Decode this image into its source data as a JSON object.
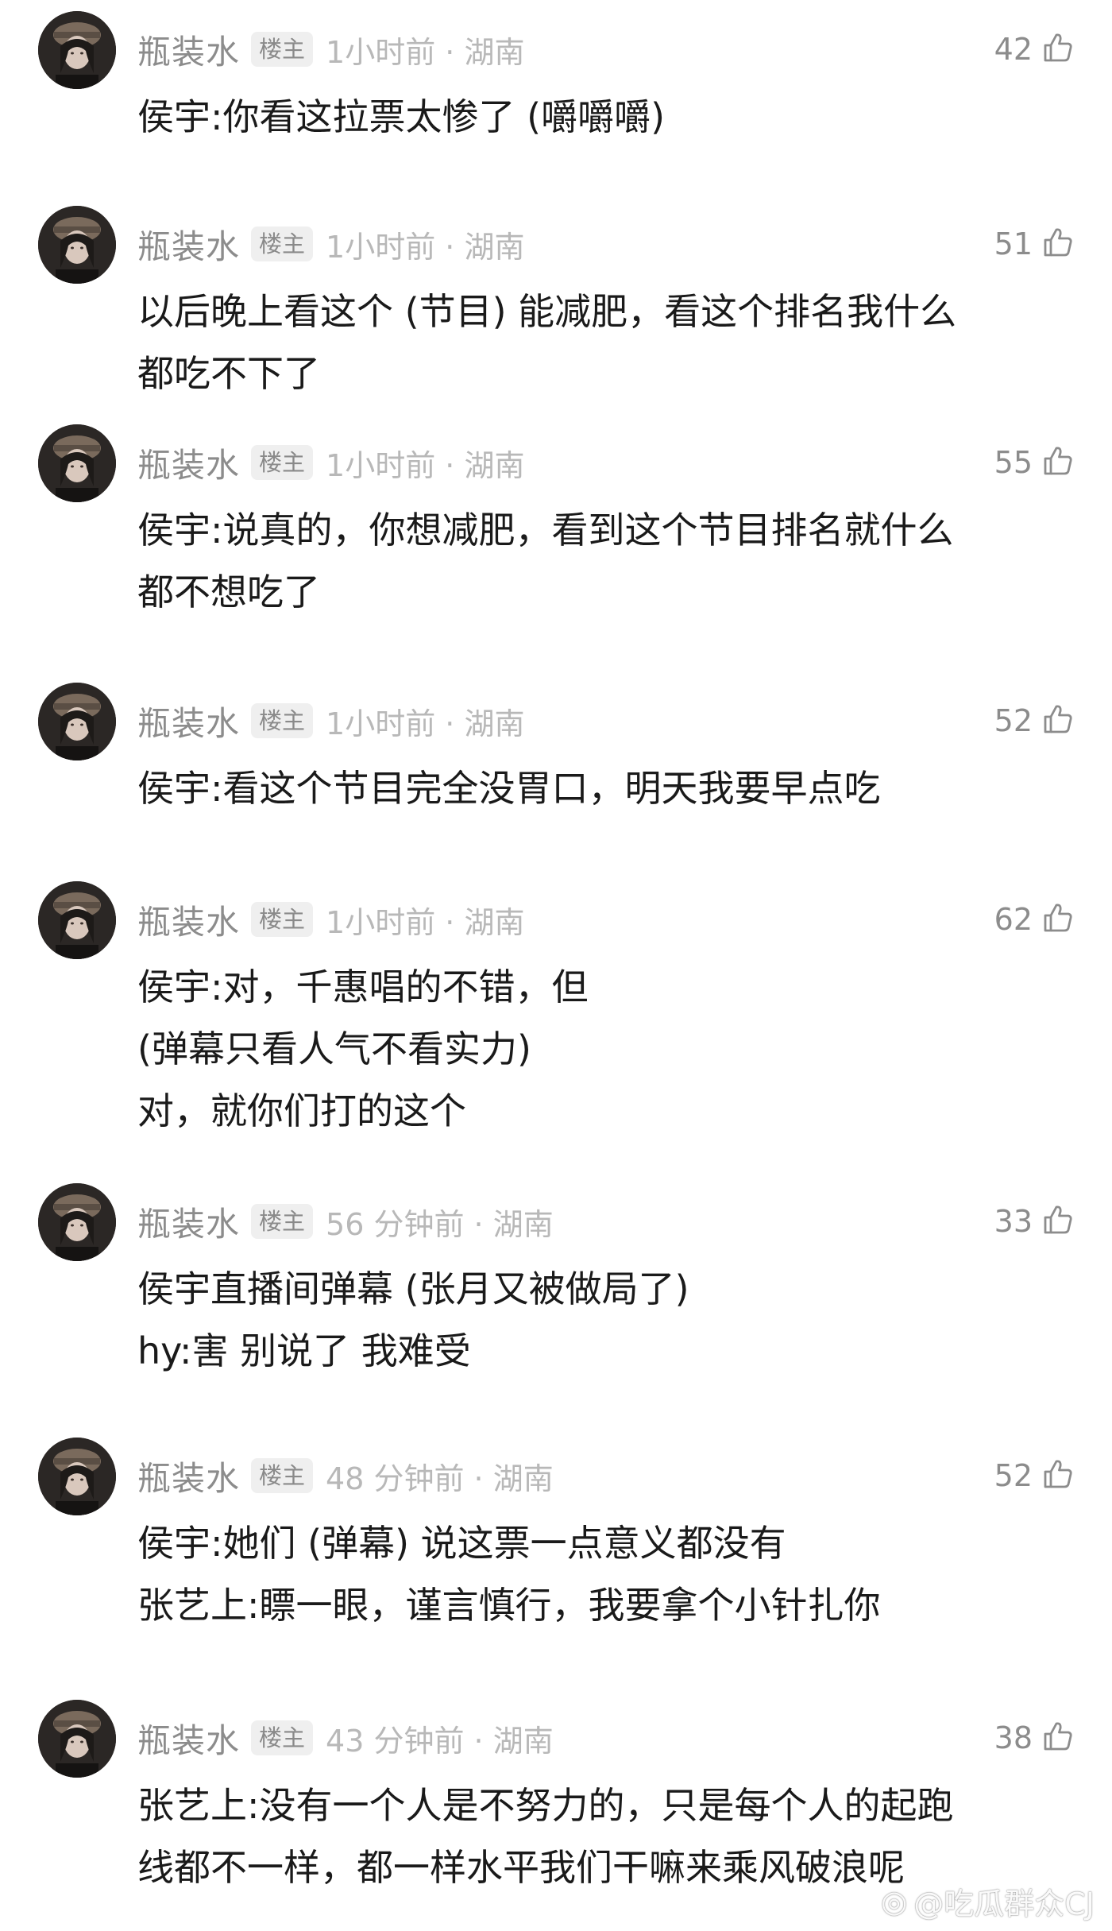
{
  "comments": [
    {
      "username": "瓶装水",
      "badge": "楼主",
      "time": "1小时前 · 湖南",
      "likes": "42",
      "lines": [
        "侯宇:你看这拉票太惨了 (嚼嚼嚼)"
      ]
    },
    {
      "username": "瓶装水",
      "badge": "楼主",
      "time": "1小时前 · 湖南",
      "likes": "51",
      "lines": [
        "以后晚上看这个 (节目) 能减肥，看这个排名我什么",
        "都吃不下了"
      ]
    },
    {
      "username": "瓶装水",
      "badge": "楼主",
      "time": "1小时前 · 湖南",
      "likes": "55",
      "lines": [
        "侯宇:说真的，你想减肥，看到这个节目排名就什么",
        "都不想吃了"
      ]
    },
    {
      "username": "瓶装水",
      "badge": "楼主",
      "time": "1小时前 · 湖南",
      "likes": "52",
      "lines": [
        "侯宇:看这个节目完全没胃口，明天我要早点吃"
      ]
    },
    {
      "username": "瓶装水",
      "badge": "楼主",
      "time": "1小时前 · 湖南",
      "likes": "62",
      "lines": [
        "侯宇:对，千惠唱的不错，但",
        "(弹幕只看人气不看实力)",
        "对，就你们打的这个"
      ]
    },
    {
      "username": "瓶装水",
      "badge": "楼主",
      "time": "56 分钟前 · 湖南",
      "likes": "33",
      "lines": [
        "侯宇直播间弹幕 (张月又被做局了)",
        "hy:害 别说了 我难受"
      ]
    },
    {
      "username": "瓶装水",
      "badge": "楼主",
      "time": "48 分钟前 · 湖南",
      "likes": "52",
      "lines": [
        "侯宇:她们 (弹幕) 说这票一点意义都没有",
        "张艺上:瞟一眼，谨言慎行，我要拿个小针扎你"
      ]
    },
    {
      "username": "瓶装水",
      "badge": "楼主",
      "time": "43 分钟前 · 湖南",
      "likes": "38",
      "lines": [
        "张艺上:没有一个人是不努力的，只是每个人的起跑",
        "线都不一样，都一样水平我们干嘛来乘风破浪呢"
      ]
    }
  ],
  "icons": {
    "avatar": "avatar-image",
    "like": "thumbs-up-icon",
    "watermark_logo": "weibo-icon"
  },
  "watermark": {
    "text": "@吃瓜群众CJ"
  },
  "colors": {
    "username": "#8c8c8c",
    "meta": "#b8b8b8",
    "text": "#1a1a1a",
    "badge_bg": "#efefef"
  }
}
